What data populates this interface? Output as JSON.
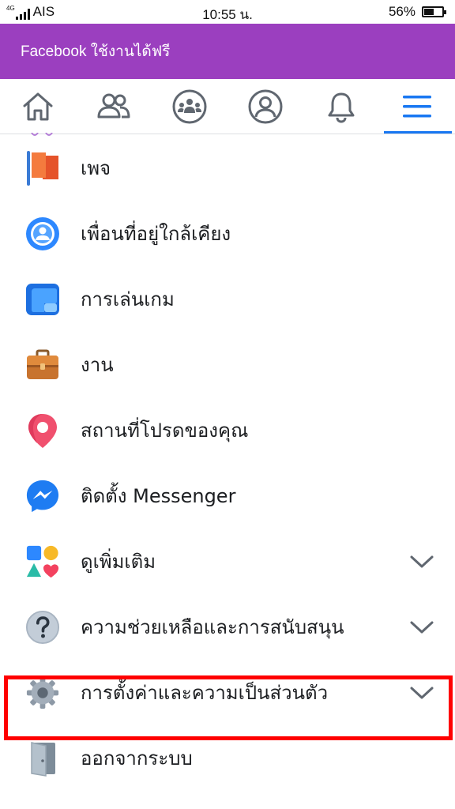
{
  "status_bar": {
    "network_type": "4G",
    "carrier": "AIS",
    "time": "10:55 น.",
    "battery": "56%",
    "battery_level": 0.56
  },
  "promo": {
    "text": "Facebook ใช้งานได้ฟรี",
    "color": "#9b3fbf"
  },
  "tabs": [
    {
      "icon": "home-icon"
    },
    {
      "icon": "friends-icon"
    },
    {
      "icon": "groups-icon"
    },
    {
      "icon": "profile-icon"
    },
    {
      "icon": "notifications-icon"
    },
    {
      "icon": "menu-icon",
      "active": true
    }
  ],
  "accent_color": "#1877f2",
  "menu": {
    "items": [
      {
        "label": "เพจ",
        "icon": "pages-flag-icon"
      },
      {
        "label": "เพื่อนที่อยู่ใกล้เคียง",
        "icon": "nearby-friends-icon"
      },
      {
        "label": "การเล่นเกม",
        "icon": "gaming-icon"
      },
      {
        "label": "งาน",
        "icon": "jobs-briefcase-icon"
      },
      {
        "label": "สถานที่โปรดของคุณ",
        "icon": "location-pin-icon"
      },
      {
        "label": "ติดตั้ง Messenger",
        "icon": "messenger-icon"
      },
      {
        "label": "ดูเพิ่มเติม",
        "icon": "see-more-shapes-icon",
        "expandable": true
      },
      {
        "label": "ความช่วยเหลือและการสนับสนุน",
        "icon": "help-question-icon",
        "expandable": true
      },
      {
        "label": "การตั้งค่าและความเป็นส่วนตัว",
        "icon": "settings-gear-icon",
        "expandable": true,
        "highlighted": true
      },
      {
        "label": "ออกจากระบบ",
        "icon": "logout-door-icon"
      }
    ]
  }
}
